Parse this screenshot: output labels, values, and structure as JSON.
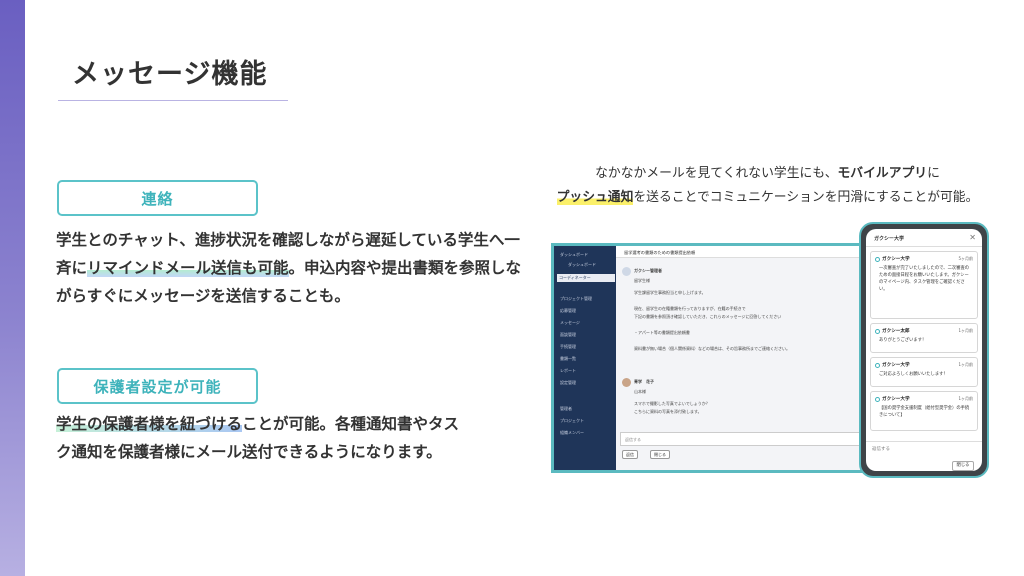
{
  "page": {
    "title": "メッセージ機能",
    "accent_color": "#5bc3c9",
    "sidebar_color": "#6a5fc1"
  },
  "feature_contact": {
    "tag": "連絡",
    "text_1": "学生とのチャット、進捗状況を確認しながら遅延している学生へ一斉に",
    "text_highlight": "リマインドメール送信も可能",
    "text_2": "。申込内容や提出書類を参照しながらすぐにメッセージを送信することも。"
  },
  "feature_guardian": {
    "tag": "保護者設定が可能",
    "text_highlight": "学生の保護者様を紐づける",
    "text_2": "ことが可能。各種通知書やタスク通知を保護者様にメール送付できるようになります。"
  },
  "caption": {
    "line1_a": "なかなかメールを見てくれない学生にも、",
    "line1_strong": "モバイルアプリ",
    "line1_b": "に",
    "line2_highlight": "プッシュ通知",
    "line2_b": "を送ることでコミュニケーションを円滑にすることが可能。"
  },
  "desktop": {
    "sidebar_items": [
      "ダッシュボード",
      "ダッシュボード",
      "コーディネーター",
      "プロジェクト管理",
      "応募管理",
      "メッセージ",
      "面談管理",
      "手続管理",
      "書類一覧",
      "レポート",
      "設定管理",
      "管理者",
      "プロジェクト",
      "組織メンバー"
    ],
    "header": "留学選考の書類のための書類提出依頼",
    "sender": "ガクシー管理者",
    "lines": [
      "留学生様",
      "学生課留学生事務担当と申し上げます。",
      "現在、留学生の在籍書類を行っておりますが、在籍の手続きで",
      "下記の書類を参照頂き確認していただき、これらのメッセージに回答してください",
      "・アパート等の書類提出依頼書",
      "資料書が無い場合（個人関係資料）などの場合は、その旨事務所までご連絡ください。"
    ],
    "reply_sender": "青学　花子",
    "reply_lines": [
      "山本様",
      "スマホで撮影した写真でよいでしょうか？",
      "こちらに資料の写真を添付致します。"
    ],
    "reply_placeholder": "返信する",
    "buttons": [
      "返信",
      "閉じる"
    ]
  },
  "phone": {
    "header": "ガクシー大学",
    "messages": [
      {
        "sender": "ガクシー大学",
        "time": "5ヶ月前",
        "text": "一次審査が完了いたしましたので、二次審査のための面接日程をお願いいたします。ガクシーのマイページ内、タスク管理をご確認ください。"
      },
      {
        "sender": "ガクシー太郎",
        "time": "1ヶ月前",
        "text": "ありがとうございます！"
      },
      {
        "sender": "ガクシー大学",
        "time": "1ヶ月前",
        "text": "ご対応よろしくお願いいたします！"
      },
      {
        "sender": "ガクシー大学",
        "time": "1ヶ月前",
        "text": "【国の奨学金支援制度（給付型奨学金）の手続きについて】"
      }
    ],
    "input_placeholder": "返信する",
    "send_label": "閉じる"
  }
}
